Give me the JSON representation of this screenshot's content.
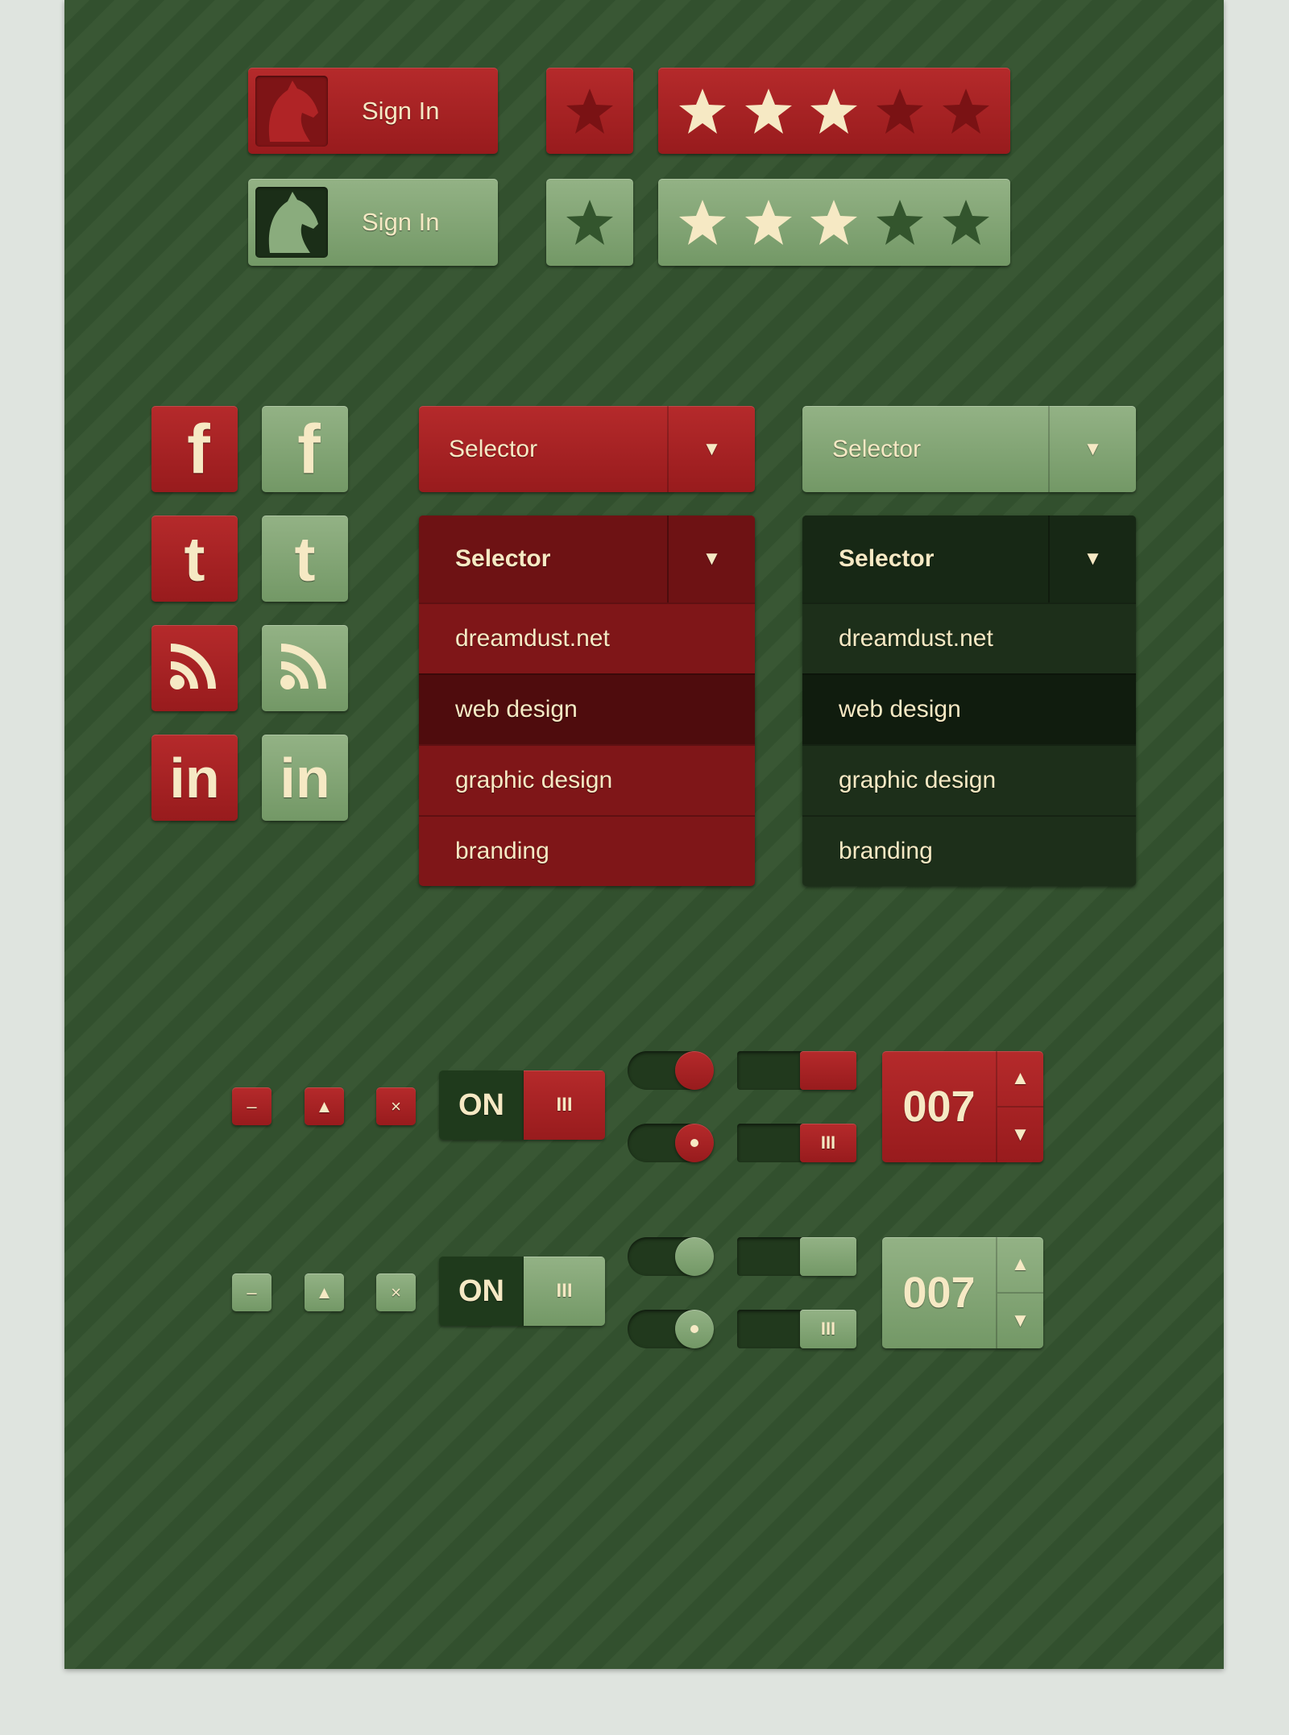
{
  "colors": {
    "background": "#34532f",
    "red": "#a82325",
    "green": "#84a676",
    "cream": "#f6e9c4",
    "dark": "#1f3a1c"
  },
  "signin": {
    "label": "Sign In",
    "icon": "horse-icon"
  },
  "rating": {
    "max": 5,
    "value": 3,
    "single_filled": false
  },
  "social": [
    {
      "name": "facebook",
      "glyph": "f"
    },
    {
      "name": "twitter",
      "glyph": "t"
    },
    {
      "name": "rss",
      "glyph": ""
    },
    {
      "name": "linkedin",
      "glyph": "in"
    }
  ],
  "selector": {
    "label": "Selector",
    "arrow": "▼",
    "options": [
      "dreamdust.net",
      "web design",
      "graphic design",
      "branding"
    ],
    "highlighted": "web design"
  },
  "controls": {
    "minus": "–",
    "up": "▲",
    "close": "×",
    "toggle_label": "ON",
    "grip": "III",
    "stepper_value": "007",
    "stepper_up": "▲",
    "stepper_down": "▼"
  }
}
